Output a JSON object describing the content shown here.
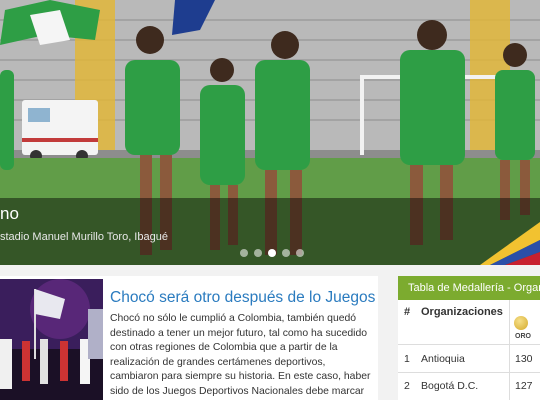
{
  "hero": {
    "caption_title": "no",
    "caption_subtitle": "stadio Manuel Murillo Toro, Ibagué",
    "slides_count": 5,
    "active_slide": 3,
    "accent_green": "#2e9e45",
    "pitch_green": "#6aa84f"
  },
  "news": {
    "title": "Chocó será otro después de lo Juegos",
    "body": "Chocó no sólo le cumplió a Colombia, también quedó destinado a tener un mejor futuro, tal como ha sucedido con otras regiones de Colombia que a partir de la realización de grandes certámenes deportivos, cambiaron para siempre su historia. En este caso, haber sido de los Juegos Deportivos Nacionales debe marcar un antes y un después."
  },
  "medal_table": {
    "header": "Tabla de Medallería - Organizaciones",
    "col_rank": "#",
    "col_org": "Organizaciones",
    "col_gold": "ORO",
    "header_color": "#7cab2f",
    "rows": [
      {
        "rank": "1",
        "org": "Antioquia",
        "gold": "130"
      },
      {
        "rank": "2",
        "org": "Bogotá D.C.",
        "gold": "127"
      }
    ]
  }
}
